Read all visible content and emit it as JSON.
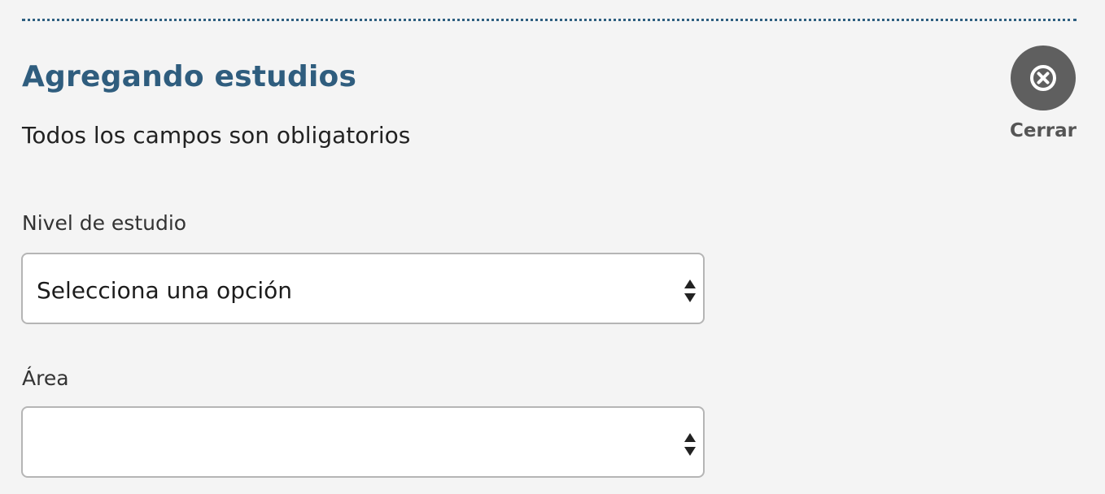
{
  "header": {
    "title": "Agregando estudios",
    "subtitle": "Todos los campos son obligatorios"
  },
  "close": {
    "label": "Cerrar",
    "icon": "close-circle-icon"
  },
  "fields": [
    {
      "label": "Nivel de estudio",
      "value": "Selecciona una opción",
      "icon": "select-arrows-icon"
    },
    {
      "label": "Área",
      "value": "",
      "icon": "select-arrows-icon"
    }
  ],
  "colors": {
    "background": "#f4f4f4",
    "title": "#2f5d7e",
    "divider": "#2e5f80",
    "close_button": "#5f5f5f",
    "close_label": "#555555",
    "select_border": "#b5b5b5"
  }
}
